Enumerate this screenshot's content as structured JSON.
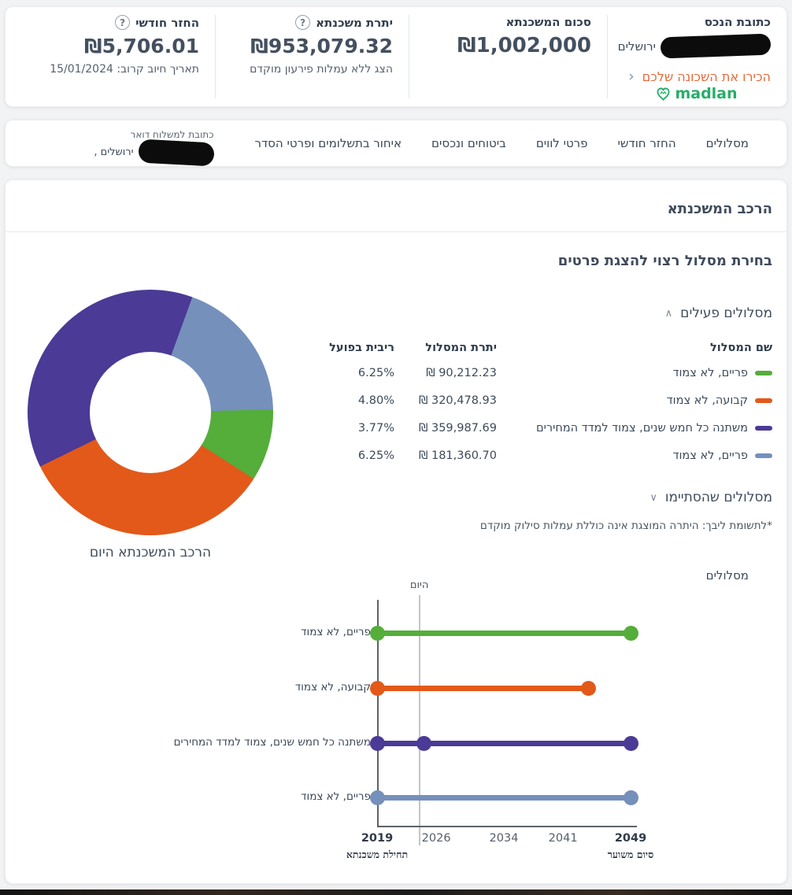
{
  "icons": {
    "help": "?",
    "chevron_left": "‹",
    "section_expanded": "∧",
    "section_collapsed": "∨"
  },
  "summary": {
    "address": {
      "label": "כתובת הנכס",
      "city": "ירושלים",
      "neighborhood_link": "הכירו את השכונה שלכם",
      "brand": "madlan"
    },
    "amount": {
      "label": "סכום המשכנתא",
      "value": "₪1,002,000"
    },
    "balance": {
      "label": "יתרת משכנתא",
      "value": "₪953,079.32",
      "link": "הצג ללא עמלות פירעון מוקדם"
    },
    "monthly": {
      "label": "החזר חודשי",
      "value": "₪5,706.01",
      "next_charge": "תאריך חיוב קרוב: 15/01/2024"
    }
  },
  "nav": {
    "items": [
      {
        "label": "מסלולים"
      },
      {
        "label": "החזר חודשי"
      },
      {
        "label": "פרטי לווים"
      },
      {
        "label": "ביטוחים ונכסים"
      },
      {
        "label": "איחור בתשלומים ופרטי הסדר"
      }
    ],
    "mail": {
      "label": "כתובת למשלוח דואר",
      "city": "ירושלים ,"
    }
  },
  "main": {
    "title": "הרכב המשכנתא",
    "subtitle": "בחירת מסלול רצוי להצגת פרטים",
    "active_section": "מסלולים פעילים",
    "finished_section": "מסלולים שהסתיימו",
    "note": "*לתשומת ליבך: היתרה המוצגת אינה כוללת עמלות סילוק מוקדם",
    "donut_caption": "הרכב המשכנתא היום",
    "table": {
      "headers": {
        "name": "שם המסלול",
        "balance": "יתרת המסלול",
        "rate": "ריבית בפועל"
      },
      "rows": [
        {
          "name": "פריים, לא צמוד",
          "color": "#55ad3a",
          "balance": "₪ 90,212.23",
          "rate": "6.25%"
        },
        {
          "name": "קבועה, לא צמוד",
          "color": "#e2591a",
          "balance": "₪ 320,478.93",
          "rate": "4.80%"
        },
        {
          "name": "משתנה כל חמש שנים, צמוד למדד המחירים",
          "color": "#4b3a96",
          "balance": "₪ 359,987.69",
          "rate": "3.77%"
        },
        {
          "name": "פריים, לא צמוד",
          "color": "#7590bb",
          "balance": "₪ 181,360.70",
          "rate": "6.25%"
        }
      ]
    }
  },
  "chart_data": [
    {
      "type": "pie",
      "title": "הרכב המשכנתא היום",
      "donut": true,
      "start_angle_deg": 20,
      "segments": [
        {
          "label": "פריים, לא צמוד",
          "value": 181360.7,
          "color": "#7590bb"
        },
        {
          "label": "פריים, לא צמוד",
          "value": 90212.23,
          "color": "#55ad3a"
        },
        {
          "label": "קבועה, לא צמוד",
          "value": 320478.93,
          "color": "#e2591a"
        },
        {
          "label": "משתנה כל חמש שנים, צמוד למדד המחירים",
          "value": 359987.69,
          "color": "#4b3a96"
        }
      ]
    },
    {
      "type": "timeline",
      "title": "מסלולים",
      "today_label": "היום",
      "today_year": 2024,
      "x_range": [
        2019,
        2049
      ],
      "x_ticks": [
        2019,
        2026,
        2034,
        2041,
        2049
      ],
      "x_start_sublabel": "תחילת משכנתא",
      "x_end_sublabel": "סיום משוער",
      "rows": [
        {
          "name": "פריים, לא צמוד",
          "color": "#55ad3a",
          "start": 2019,
          "end": 2049,
          "markers": [
            2019,
            2049
          ]
        },
        {
          "name": "קבועה, לא צמוד",
          "color": "#e2591a",
          "start": 2019,
          "end": 2044,
          "markers": [
            2019,
            2044
          ]
        },
        {
          "name": "משתנה כל חמש שנים, צמוד למדד המחירים",
          "color": "#4b3a96",
          "start": 2019,
          "end": 2049,
          "markers": [
            2019,
            2024.5,
            2049
          ]
        },
        {
          "name": "פריים, לא צמוד",
          "color": "#7590bb",
          "start": 2019,
          "end": 2049,
          "markers": [
            2019,
            2049
          ]
        }
      ]
    }
  ]
}
